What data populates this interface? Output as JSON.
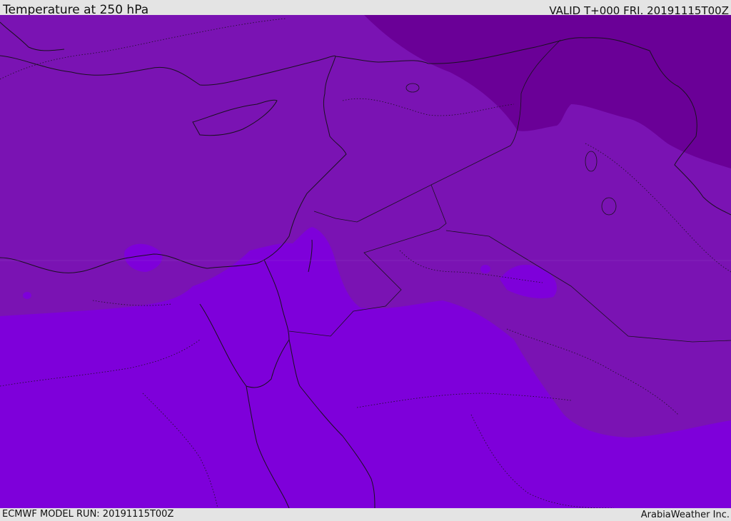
{
  "header": {
    "title": "Temperature at 250 hPa",
    "valid_time": "VALID T+000 FRI. 20191115T00Z"
  },
  "footer": {
    "model_run": "ECMWF MODEL RUN: 20191115T00Z",
    "credit": "ArabiaWeather Inc."
  },
  "map": {
    "variable": "Temperature",
    "pressure_level_hPa": 250,
    "colors": {
      "band_dark": "#6a0097",
      "band_mid": "#7a13b3",
      "band_light": "#7e00da",
      "coastline": "#1a1020"
    }
  }
}
